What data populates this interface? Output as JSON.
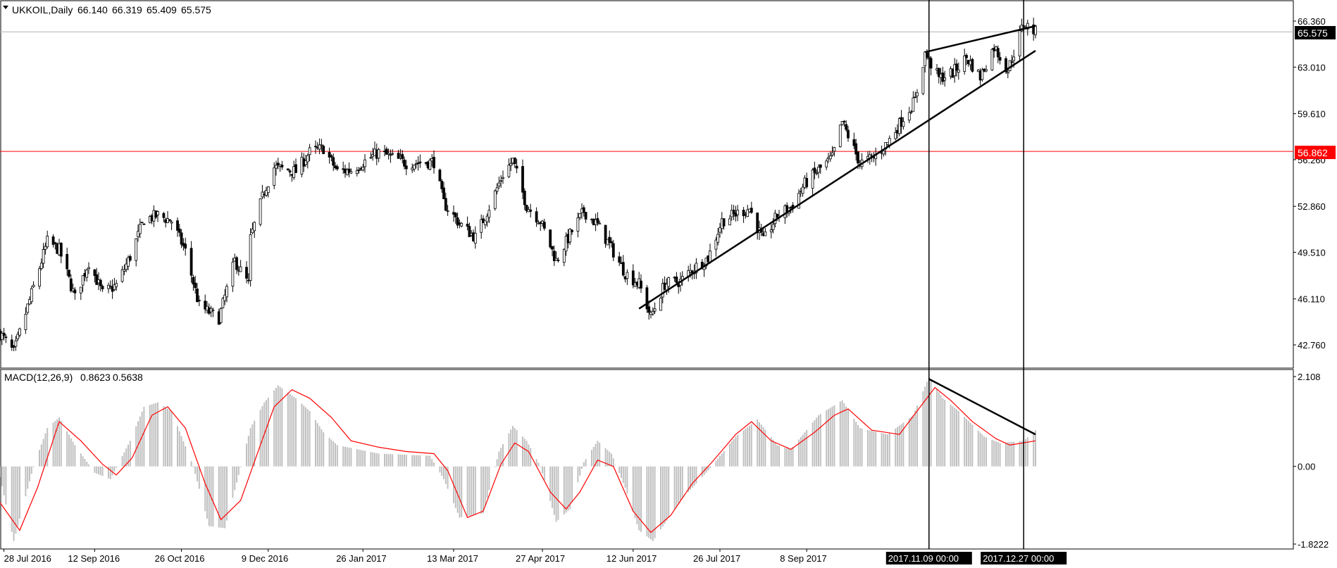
{
  "app": {
    "symbol_line": "UKKOIL,Daily",
    "ohlc": [
      "66.140",
      "66.319",
      "65.409",
      "65.575"
    ],
    "last_price_label": "65.575",
    "resistance_label": "56.862",
    "macd_line": "MACD(12,26,9)",
    "macd_values": [
      "0.8623",
      "0.5638"
    ]
  },
  "colors": {
    "background": "#ffffff",
    "candles": "#000000",
    "resistance_line": "#ff0000",
    "macd_histogram": "#c0c0c0",
    "macd_signal": "#ff0000",
    "trendlines": "#000000",
    "last_price_bg": "#000000",
    "resistance_label_bg": "#ff0000"
  },
  "chart_data": [
    {
      "type": "candlestick",
      "symbol": "UKKOIL",
      "timeframe": "Daily",
      "y_ticks": [
        "66.360",
        "63.010",
        "59.610",
        "56.260",
        "52.860",
        "49.510",
        "46.110",
        "42.760"
      ],
      "ylim": [
        41.5,
        67.5
      ],
      "x_tick_labels": [
        "28 Jul 2016",
        "12 Sep 2016",
        "26 Oct 2016",
        "9 Dec 2016",
        "26 Jan 2017",
        "13 Mar 2017",
        "27 Apr 2017",
        "12 Jun 2017",
        "26 Jul 2017",
        "8 Sep 2017"
      ],
      "x_ticks": [
        "2016-07-28",
        "2016-09-12",
        "2016-10-26",
        "2016-12-09",
        "2017-01-26",
        "2017-03-13",
        "2017-04-27",
        "2017-06-12",
        "2017-07-26",
        "2017-09-08"
      ],
      "x_range": [
        "2016-07-26",
        "2018-01-02"
      ],
      "close_path": [
        [
          "2016-07-26",
          43.6
        ],
        [
          "2016-08-02",
          42.2
        ],
        [
          "2016-08-19",
          50.3
        ],
        [
          "2016-08-25",
          49.7
        ],
        [
          "2016-09-02",
          46.2
        ],
        [
          "2016-09-09",
          48.8
        ],
        [
          "2016-09-16",
          46.5
        ],
        [
          "2016-09-23",
          47.1
        ],
        [
          "2016-09-30",
          49.2
        ],
        [
          "2016-10-07",
          51.9
        ],
        [
          "2016-10-14",
          52.2
        ],
        [
          "2016-10-21",
          51.8
        ],
        [
          "2016-10-28",
          49.6
        ],
        [
          "2016-11-04",
          45.6
        ],
        [
          "2016-11-14",
          44.7
        ],
        [
          "2016-11-22",
          48.9
        ],
        [
          "2016-11-29",
          47.2
        ],
        [
          "2016-11-30",
          50.5
        ],
        [
          "2016-12-07",
          54.0
        ],
        [
          "2016-12-12",
          55.7
        ],
        [
          "2016-12-23",
          55.4
        ],
        [
          "2016-12-30",
          56.8
        ],
        [
          "2017-01-06",
          57.1
        ],
        [
          "2017-01-13",
          55.4
        ],
        [
          "2017-01-20",
          55.5
        ],
        [
          "2017-02-03",
          56.8
        ],
        [
          "2017-02-17",
          56.0
        ],
        [
          "2017-03-03",
          56.1
        ],
        [
          "2017-03-08",
          53.1
        ],
        [
          "2017-03-16",
          51.6
        ],
        [
          "2017-03-24",
          50.6
        ],
        [
          "2017-03-31",
          52.8
        ],
        [
          "2017-04-07",
          55.2
        ],
        [
          "2017-04-12",
          56.2
        ],
        [
          "2017-04-19",
          52.9
        ],
        [
          "2017-04-26",
          51.8
        ],
        [
          "2017-05-04",
          48.9
        ],
        [
          "2017-05-11",
          50.8
        ],
        [
          "2017-05-18",
          52.5
        ],
        [
          "2017-05-25",
          51.5
        ],
        [
          "2017-06-01",
          49.8
        ],
        [
          "2017-06-08",
          48.0
        ],
        [
          "2017-06-15",
          47.2
        ],
        [
          "2017-06-21",
          44.8
        ],
        [
          "2017-06-28",
          47.2
        ],
        [
          "2017-07-06",
          47.4
        ],
        [
          "2017-07-13",
          48.4
        ],
        [
          "2017-07-20",
          49.1
        ],
        [
          "2017-07-27",
          51.8
        ],
        [
          "2017-08-03",
          52.3
        ],
        [
          "2017-08-10",
          52.7
        ],
        [
          "2017-08-17",
          50.3
        ],
        [
          "2017-08-24",
          52.2
        ],
        [
          "2017-08-31",
          52.8
        ],
        [
          "2017-09-07",
          54.5
        ],
        [
          "2017-09-14",
          55.5
        ],
        [
          "2017-09-21",
          56.4
        ],
        [
          "2017-09-26",
          59.0
        ],
        [
          "2017-10-05",
          56.0
        ],
        [
          "2017-10-12",
          56.4
        ],
        [
          "2017-10-19",
          57.5
        ],
        [
          "2017-10-26",
          59.1
        ],
        [
          "2017-11-02",
          60.6
        ],
        [
          "2017-11-07",
          64.0
        ],
        [
          "2017-11-14",
          62.2
        ],
        [
          "2017-11-21",
          62.6
        ],
        [
          "2017-11-28",
          63.7
        ],
        [
          "2017-12-05",
          62.3
        ],
        [
          "2017-12-12",
          64.5
        ],
        [
          "2017-12-19",
          62.8
        ],
        [
          "2017-12-27",
          66.2
        ],
        [
          "2018-01-02",
          65.575
        ]
      ],
      "horizontal_line": {
        "value": 56.862,
        "color": "#ff0000"
      },
      "last_price": 65.575,
      "trendlines": [
        {
          "from": [
            "2017-06-15",
            45.4
          ],
          "to": [
            "2018-01-02",
            64.2
          ]
        },
        {
          "from": [
            "2017-11-07",
            64.1
          ],
          "to": [
            "2018-01-02",
            66.0
          ]
        }
      ],
      "vertical_markers": [
        {
          "date": "2017-11-09",
          "label": "2017.11.09 00:00"
        },
        {
          "date": "2017-12-27",
          "label": "2017.12.27 00:00"
        }
      ]
    },
    {
      "type": "bar",
      "indicator": "MACD(12,26,9)",
      "y_ticks": [
        "2.108",
        "0.00",
        "-1.8222"
      ],
      "ylim": [
        -1.95,
        2.2
      ],
      "histogram_path": [
        [
          "2016-07-26",
          -0.25
        ],
        [
          "2016-08-02",
          -1.75
        ],
        [
          "2016-08-12",
          0.0
        ],
        [
          "2016-08-19",
          0.9
        ],
        [
          "2016-08-25",
          1.15
        ],
        [
          "2016-09-02",
          0.5
        ],
        [
          "2016-09-12",
          -0.15
        ],
        [
          "2016-09-20",
          -0.3
        ],
        [
          "2016-09-30",
          0.6
        ],
        [
          "2016-10-07",
          1.4
        ],
        [
          "2016-10-14",
          1.5
        ],
        [
          "2016-10-21",
          1.3
        ],
        [
          "2016-11-01",
          0.0
        ],
        [
          "2016-11-09",
          -1.4
        ],
        [
          "2016-11-17",
          -1.45
        ],
        [
          "2016-11-24",
          -0.2
        ],
        [
          "2016-11-30",
          0.9
        ],
        [
          "2016-12-07",
          1.5
        ],
        [
          "2016-12-14",
          1.9
        ],
        [
          "2016-12-23",
          1.6
        ],
        [
          "2016-12-30",
          1.3
        ],
        [
          "2017-01-06",
          0.8
        ],
        [
          "2017-01-13",
          0.5
        ],
        [
          "2017-02-03",
          0.3
        ],
        [
          "2017-03-01",
          0.25
        ],
        [
          "2017-03-08",
          -0.3
        ],
        [
          "2017-03-16",
          -1.2
        ],
        [
          "2017-03-28",
          -1.1
        ],
        [
          "2017-04-05",
          0.35
        ],
        [
          "2017-04-12",
          0.95
        ],
        [
          "2017-04-19",
          0.6
        ],
        [
          "2017-04-26",
          0.0
        ],
        [
          "2017-05-04",
          -1.3
        ],
        [
          "2017-05-11",
          -1.0
        ],
        [
          "2017-05-18",
          0.1
        ],
        [
          "2017-05-25",
          0.6
        ],
        [
          "2017-06-01",
          0.3
        ],
        [
          "2017-06-08",
          -0.5
        ],
        [
          "2017-06-15",
          -1.5
        ],
        [
          "2017-06-22",
          -1.75
        ],
        [
          "2017-07-06",
          -0.8
        ],
        [
          "2017-07-20",
          -0.1
        ],
        [
          "2017-08-03",
          0.7
        ],
        [
          "2017-08-14",
          1.1
        ],
        [
          "2017-08-24",
          0.5
        ],
        [
          "2017-08-31",
          0.4
        ],
        [
          "2017-09-14",
          1.2
        ],
        [
          "2017-09-26",
          1.55
        ],
        [
          "2017-10-05",
          0.9
        ],
        [
          "2017-10-19",
          0.75
        ],
        [
          "2017-11-01",
          1.2
        ],
        [
          "2017-11-09",
          2.1
        ],
        [
          "2017-11-16",
          1.6
        ],
        [
          "2017-11-24",
          1.3
        ],
        [
          "2017-12-07",
          0.7
        ],
        [
          "2017-12-15",
          0.55
        ],
        [
          "2017-12-27",
          0.6
        ],
        [
          "2018-01-02",
          0.85
        ]
      ],
      "signal_path": [
        [
          "2016-07-26",
          -0.85
        ],
        [
          "2016-08-05",
          -1.5
        ],
        [
          "2016-08-14",
          -0.5
        ],
        [
          "2016-08-25",
          1.05
        ],
        [
          "2016-09-05",
          0.6
        ],
        [
          "2016-09-16",
          0.05
        ],
        [
          "2016-09-23",
          -0.2
        ],
        [
          "2016-10-01",
          0.2
        ],
        [
          "2016-10-11",
          1.2
        ],
        [
          "2016-10-19",
          1.4
        ],
        [
          "2016-10-28",
          0.9
        ],
        [
          "2016-11-07",
          -0.4
        ],
        [
          "2016-11-15",
          -1.25
        ],
        [
          "2016-11-25",
          -0.8
        ],
        [
          "2016-12-05",
          0.5
        ],
        [
          "2016-12-12",
          1.4
        ],
        [
          "2016-12-21",
          1.8
        ],
        [
          "2016-12-30",
          1.6
        ],
        [
          "2017-01-10",
          1.15
        ],
        [
          "2017-01-20",
          0.6
        ],
        [
          "2017-02-03",
          0.45
        ],
        [
          "2017-02-17",
          0.35
        ],
        [
          "2017-03-03",
          0.3
        ],
        [
          "2017-03-10",
          -0.1
        ],
        [
          "2017-03-20",
          -1.2
        ],
        [
          "2017-03-28",
          -1.05
        ],
        [
          "2017-04-06",
          0.05
        ],
        [
          "2017-04-13",
          0.55
        ],
        [
          "2017-04-20",
          0.35
        ],
        [
          "2017-05-01",
          -0.6
        ],
        [
          "2017-05-09",
          -1.0
        ],
        [
          "2017-05-16",
          -0.6
        ],
        [
          "2017-05-25",
          0.15
        ],
        [
          "2017-06-02",
          0.0
        ],
        [
          "2017-06-12",
          -1.05
        ],
        [
          "2017-06-21",
          -1.55
        ],
        [
          "2017-07-01",
          -1.15
        ],
        [
          "2017-07-12",
          -0.4
        ],
        [
          "2017-07-22",
          0.1
        ],
        [
          "2017-08-03",
          0.75
        ],
        [
          "2017-08-11",
          1.05
        ],
        [
          "2017-08-21",
          0.6
        ],
        [
          "2017-08-31",
          0.4
        ],
        [
          "2017-09-12",
          0.8
        ],
        [
          "2017-09-22",
          1.2
        ],
        [
          "2017-09-29",
          1.35
        ],
        [
          "2017-10-11",
          0.85
        ],
        [
          "2017-10-25",
          0.75
        ],
        [
          "2017-11-03",
          1.3
        ],
        [
          "2017-11-12",
          1.85
        ],
        [
          "2017-11-20",
          1.55
        ],
        [
          "2017-12-01",
          1.05
        ],
        [
          "2017-12-13",
          0.65
        ],
        [
          "2017-12-20",
          0.5
        ],
        [
          "2018-01-02",
          0.6
        ]
      ],
      "trendline": {
        "from": [
          "2017-11-09",
          2.05
        ],
        "to": [
          "2018-01-02",
          0.75
        ]
      }
    }
  ]
}
